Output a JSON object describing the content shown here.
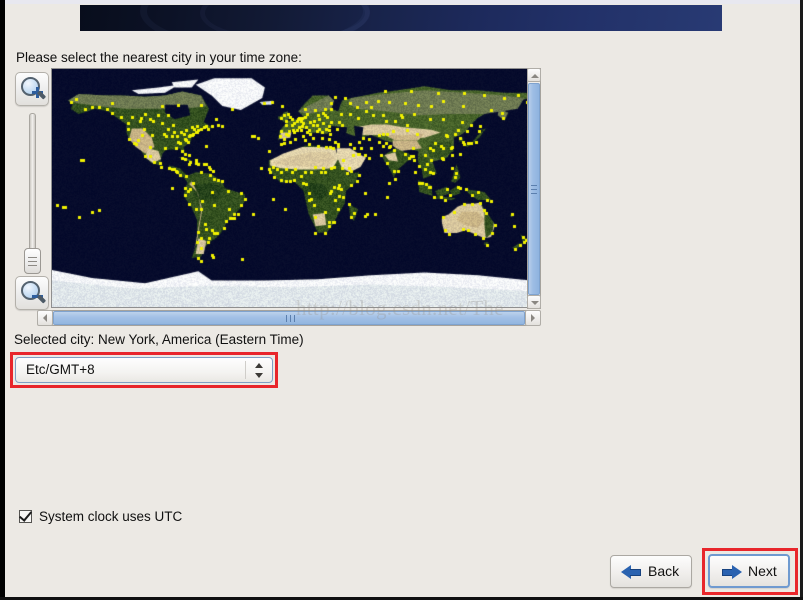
{
  "window": {
    "background_color": "#ece9e4",
    "banner": {
      "name": "installer-banner",
      "gradient_from": "#080d1c",
      "gradient_to": "#283a74"
    }
  },
  "prompt": {
    "text": "Please select the nearest city in your time zone:"
  },
  "map": {
    "ocean_color": "#060b2c",
    "city_dot_color": "#f2f200",
    "watermark": "http://blog.csdn.net/The",
    "zoom_in_icon": "magnifier-plus-icon",
    "zoom_out_icon": "magnifier-minus-icon",
    "zoom_slider": {
      "name": "map-zoom-slider",
      "orientation": "vertical"
    },
    "vertical_scrollbar": {
      "up_icon": "chevron-up-icon",
      "down_icon": "chevron-down-icon"
    },
    "horizontal_scrollbar": {
      "left_icon": "chevron-left-icon",
      "right_icon": "chevron-right-icon"
    }
  },
  "selection": {
    "selected_city_label": "Selected city: New York, America (Eastern Time)",
    "timezone_combo": {
      "value": "Etc/GMT+8",
      "chevron_icon": "updown-chevron-icon",
      "highlight_color": "#e8262b"
    }
  },
  "options": {
    "utc_checkbox": {
      "label": "System clock uses UTC",
      "checked": true
    }
  },
  "navigation": {
    "back": {
      "label": "Back",
      "icon": "arrow-left-icon"
    },
    "next": {
      "label": "Next",
      "icon": "arrow-right-icon",
      "focused": true,
      "highlight_color": "#e8262b"
    }
  }
}
